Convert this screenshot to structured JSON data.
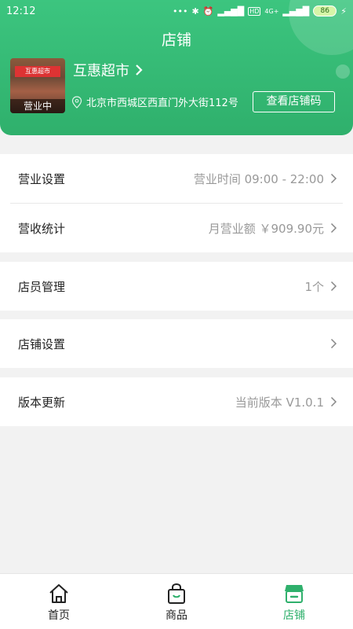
{
  "status_bar": {
    "time": "12:12",
    "signal_text": "4G+",
    "hd": "HD",
    "battery": "86"
  },
  "header": {
    "title": "店铺",
    "store_name": "互惠超市",
    "address": "北京市西城区西直门外大街112号",
    "photo_badge": "营业中",
    "photo_sign": "互惠超市",
    "qr_button": "查看店铺码"
  },
  "menu": {
    "business_settings": {
      "label": "营业设置",
      "value": "营业时间 09:00 - 22:00"
    },
    "revenue_stats": {
      "label": "营收统计",
      "value": "月营业额 ￥909.90元"
    },
    "staff": {
      "label": "店员管理",
      "value": "1个"
    },
    "store_settings": {
      "label": "店铺设置",
      "value": ""
    },
    "version": {
      "label": "版本更新",
      "value": "当前版本 V1.0.1"
    }
  },
  "tabs": [
    {
      "label": "首页",
      "icon": "home-icon"
    },
    {
      "label": "商品",
      "icon": "bag-icon"
    },
    {
      "label": "店铺",
      "icon": "store-icon"
    }
  ],
  "colors": {
    "accent": "#2fb06c",
    "header_top": "#3cc57f"
  }
}
